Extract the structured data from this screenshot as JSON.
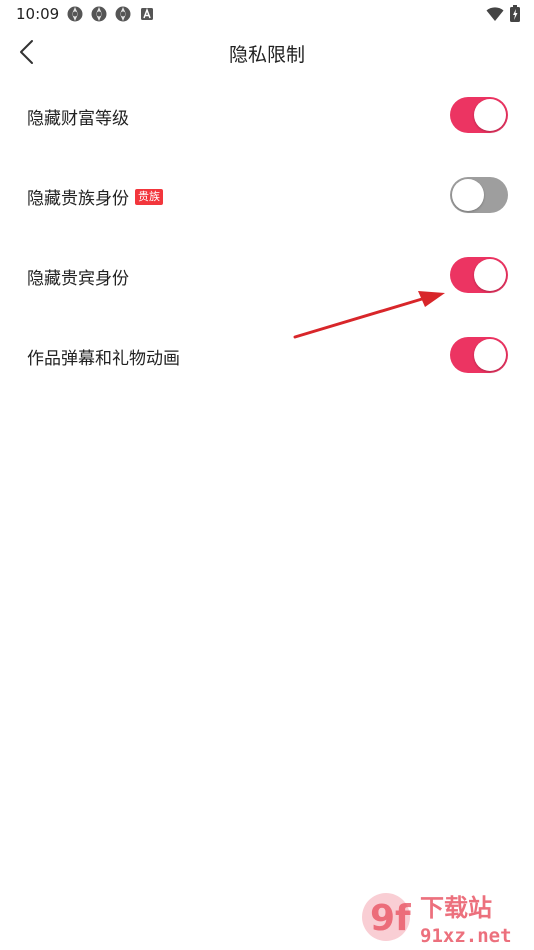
{
  "status_bar": {
    "time": "10:09",
    "notification_icons": [
      "aperture-icon",
      "aperture-icon",
      "aperture-icon",
      "a-app-icon"
    ],
    "right_icons": [
      "wifi-icon",
      "battery-charging-icon"
    ]
  },
  "header": {
    "title": "隐私限制",
    "back_icon": "chevron-left-icon"
  },
  "settings": [
    {
      "label": "隐藏财富等级",
      "badge": "",
      "enabled": true
    },
    {
      "label": "隐藏贵族身份",
      "badge": "贵族",
      "enabled": false
    },
    {
      "label": "隐藏贵宾身份",
      "badge": "",
      "enabled": true
    },
    {
      "label": "作品弹幕和礼物动画",
      "badge": "",
      "enabled": true
    }
  ],
  "annotation": {
    "icon": "red-arrow-icon",
    "color": "#d8262a"
  },
  "watermark": {
    "logo_text": "9f",
    "top_text": "下载站",
    "bottom_text": "91xz.net"
  },
  "colors": {
    "toggle_on": "#ec3462",
    "toggle_off": "#9e9e9e",
    "badge": "#f2363c"
  }
}
